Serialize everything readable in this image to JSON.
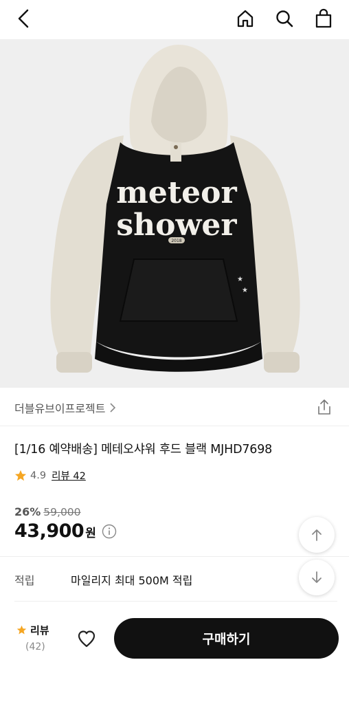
{
  "header": {
    "back_icon": "back-chevron-icon",
    "home_icon": "home-icon",
    "search_icon": "search-icon",
    "bag_icon": "shopping-bag-icon"
  },
  "product_image": {
    "print_line1": "meteor",
    "print_line2": "shower",
    "print_badge": "2018"
  },
  "brand": {
    "name": "더블유브이프로젝트",
    "chevron": "›"
  },
  "product": {
    "title": "[1/16 예약배송] 메테오샤워 후드 블랙 MJHD7698",
    "rating": "4.9",
    "review_label": "리뷰 42"
  },
  "pricing": {
    "discount": "26%",
    "original_price": "59,000",
    "price": "43,900",
    "currency": "원"
  },
  "mileage": {
    "label": "적립",
    "value": "마일리지 최대 500M 적립"
  },
  "bottom_bar": {
    "review_title": "리뷰",
    "review_count": "(42)",
    "buy_label": "구매하기"
  },
  "colors": {
    "accent_star": "#f5a623",
    "buy_button": "#111111"
  }
}
